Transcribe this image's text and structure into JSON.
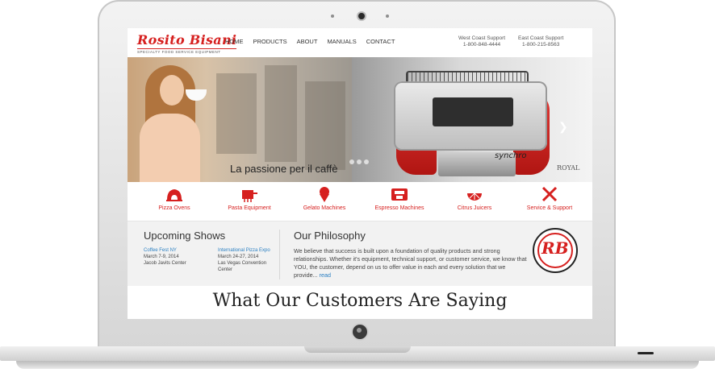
{
  "colors": {
    "brand_red": "#d6201f",
    "link_blue": "#2a7fc2",
    "band_bg": "#f2f2f2"
  },
  "header": {
    "logo_name": "Rosito Bisani",
    "logo_tagline": "SPECIALTY FOOD SERVICE EQUIPMENT",
    "nav": [
      "HOME",
      "PRODUCTS",
      "ABOUT",
      "MANUALS",
      "CONTACT"
    ],
    "support": [
      {
        "label": "West Coast Support",
        "phone": "1-800-848-4444"
      },
      {
        "label": "East Coast Support",
        "phone": "1-800-215-8563"
      }
    ]
  },
  "hero": {
    "tagline": "La passione per il caffè",
    "machine_brand": "synchro",
    "machine_logo": "ROYAL",
    "next_icon": "chevron-right-icon"
  },
  "categories": [
    {
      "label": "Pizza Ovens",
      "icon": "pizza-oven-icon"
    },
    {
      "label": "Pasta Equipment",
      "icon": "pasta-machine-icon"
    },
    {
      "label": "Gelato Machines",
      "icon": "gelato-icon"
    },
    {
      "label": "Espresso Machines",
      "icon": "espresso-machine-icon"
    },
    {
      "label": "Citrus Juicers",
      "icon": "citrus-icon"
    },
    {
      "label": "Service & Support",
      "icon": "tools-icon"
    }
  ],
  "shows": {
    "heading": "Upcoming Shows",
    "items": [
      {
        "title": "Coffee Fest NY",
        "date": "March 7-9, 2014",
        "venue": "Jacob Javits Center",
        "venue2": ""
      },
      {
        "title": "International Pizza Expo",
        "date": "March 24-27, 2014",
        "venue": "Las Vegas Convention",
        "venue2": "Center"
      }
    ]
  },
  "philosophy": {
    "heading": "Our Philosophy",
    "text": "We believe that success is built upon a foundation of quality products and strong relationships. Whether it's equipment, technical support, or customer service, we know that YOU, the customer, depend on us to offer value in each and every solution that we provide... ",
    "read_label": "read",
    "badge": "RB"
  },
  "testimonials": {
    "heading": "What Our Customers Are Saying"
  }
}
